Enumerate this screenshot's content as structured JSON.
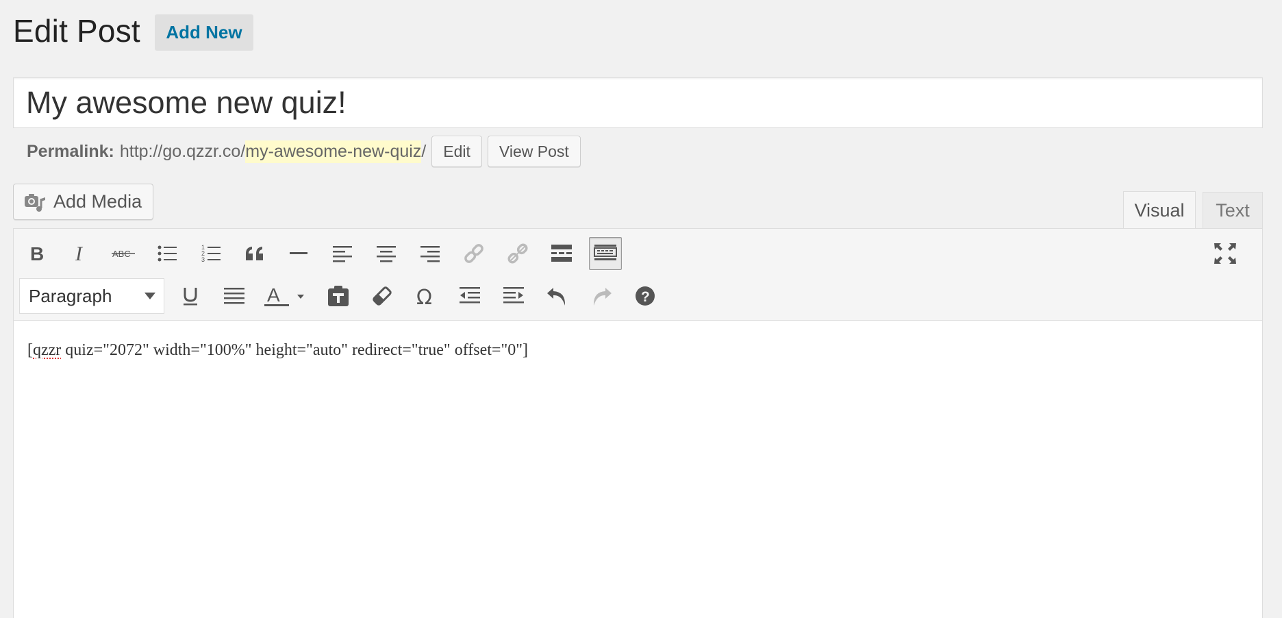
{
  "header": {
    "title": "Edit Post",
    "add_new_label": "Add New"
  },
  "post": {
    "title_value": "My awesome new quiz!"
  },
  "permalink": {
    "label": "Permalink:",
    "base": "http://go.qzzr.co/",
    "slug": "my-awesome-new-quiz",
    "trail": "/",
    "edit_label": "Edit",
    "view_label": "View Post"
  },
  "media": {
    "add_media_label": "Add Media"
  },
  "editor": {
    "tabs": [
      {
        "label": "Visual",
        "active": true
      },
      {
        "label": "Text",
        "active": false
      }
    ],
    "format_select": "Paragraph",
    "toolbar_row1": [
      "bold-icon",
      "italic-icon",
      "strikethrough-icon",
      "bulleted-list-icon",
      "numbered-list-icon",
      "blockquote-icon",
      "horizontal-line-icon",
      "align-left-icon",
      "align-center-icon",
      "align-right-icon",
      "insert-link-icon",
      "remove-link-icon",
      "read-more-icon",
      "toolbar-toggle-icon"
    ],
    "toolbar_row2": [
      "underline-icon",
      "justify-icon",
      "text-color-icon",
      "paste-as-text-icon",
      "clear-formatting-icon",
      "special-character-icon",
      "decrease-indent-icon",
      "increase-indent-icon",
      "undo-icon",
      "redo-icon",
      "help-icon"
    ],
    "content_spell_word": "qzzr",
    "content_rest": " quiz=\"2072\" width=\"100%\" height=\"auto\" redirect=\"true\" offset=\"0\"]",
    "content_open": "["
  }
}
